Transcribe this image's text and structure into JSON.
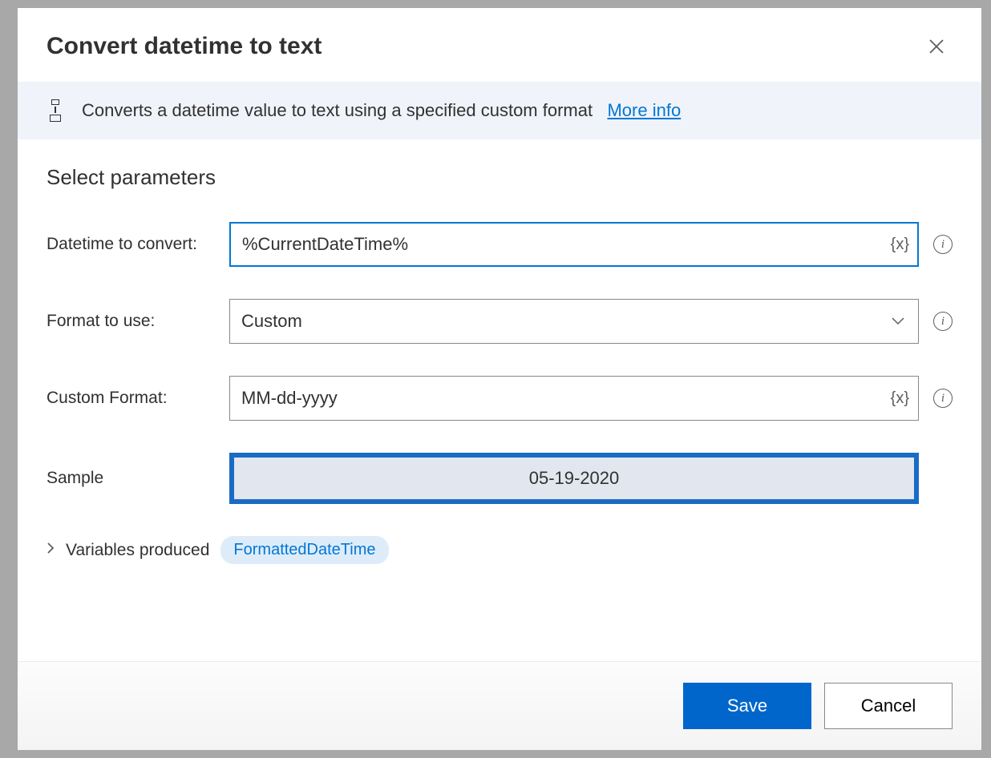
{
  "dialog": {
    "title": "Convert datetime to text",
    "description": "Converts a datetime value to text using a specified custom format",
    "moreInfo": "More info"
  },
  "section": {
    "title": "Select parameters"
  },
  "fields": {
    "datetime": {
      "label": "Datetime to convert:",
      "value": "%CurrentDateTime%"
    },
    "format": {
      "label": "Format to use:",
      "value": "Custom"
    },
    "customFormat": {
      "label": "Custom Format:",
      "value": "MM-dd-yyyy"
    },
    "sample": {
      "label": "Sample",
      "value": "05-19-2020"
    }
  },
  "variables": {
    "label": "Variables produced",
    "chip": "FormattedDateTime"
  },
  "buttons": {
    "save": "Save",
    "cancel": "Cancel"
  },
  "icons": {
    "varToken": "{x}"
  }
}
